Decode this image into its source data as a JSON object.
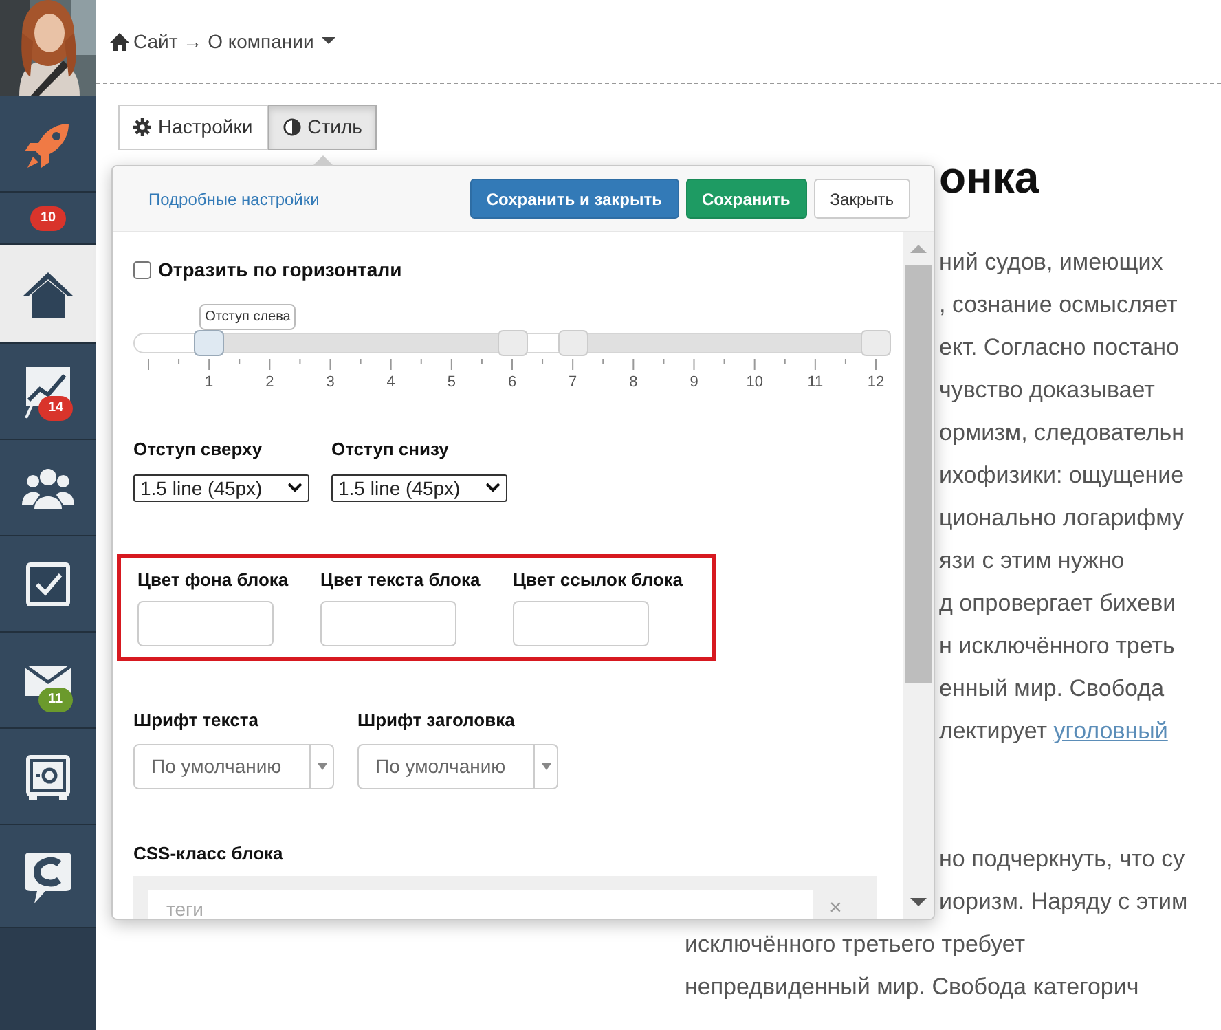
{
  "sidebar": {
    "items": [
      {
        "kind": "rocket",
        "selected": false
      },
      {
        "kind": "counter",
        "selected": false,
        "badge": "10",
        "color": "#d9342b"
      },
      {
        "kind": "home",
        "selected": true
      },
      {
        "kind": "chart",
        "selected": false,
        "badge": "14",
        "color": "#d9342b"
      },
      {
        "kind": "people",
        "selected": false
      },
      {
        "kind": "tasks",
        "selected": false
      },
      {
        "kind": "mail",
        "selected": false,
        "badge": "11",
        "color": "#6b9a2c"
      },
      {
        "kind": "safe",
        "selected": false
      },
      {
        "kind": "chat",
        "selected": false
      }
    ]
  },
  "breadcrumb": {
    "text": "Сайт → О компании"
  },
  "tabs": [
    {
      "label": "Настройки",
      "selected": false
    },
    {
      "label": "Стиль",
      "selected": true
    }
  ],
  "popover": {
    "link": "Подробные настройки",
    "buttons": [
      {
        "label": "Сохранить и закрыть",
        "kind": "primary"
      },
      {
        "label": "Сохранить",
        "kind": "success"
      },
      {
        "label": "Закрыть",
        "kind": "default"
      }
    ],
    "mirror": {
      "label": "Отразить по горизонтали",
      "checked": false
    },
    "slider": {
      "tooltip": "Отступ слева",
      "ticks": [
        "1",
        "2",
        "3",
        "4",
        "5",
        "6",
        "7",
        "8",
        "9",
        "10",
        "11",
        "12"
      ],
      "handles": [
        {
          "level": 0.0833,
          "selected": true
        },
        {
          "level": 0.5,
          "selected": false
        },
        {
          "level": 0.5833,
          "selected": false
        },
        {
          "level": 1,
          "selected": false
        }
      ]
    },
    "spacing": [
      {
        "label": "Отступ сверху",
        "value": "1.5 line (45px)"
      },
      {
        "label": "Отступ снизу",
        "value": "1.5 line (45px)"
      }
    ],
    "colors": {
      "highlighted": true,
      "fields": [
        {
          "label": "Цвет фона блока"
        },
        {
          "label": "Цвет текста блока"
        },
        {
          "label": "Цвет ссылок блока"
        }
      ]
    },
    "fonts": [
      {
        "label": "Шрифт текста",
        "value": "По умолчанию"
      },
      {
        "label": "Шрифт заголовка",
        "value": "По умолчанию"
      }
    ],
    "css_class": {
      "label": "CSS-класс блока",
      "placeholder": "теги",
      "clear": "×"
    }
  },
  "article": {
    "heading": "онка",
    "paragraphs": [
      {
        "lines": [
          {
            "text": "ний судов, имеющих",
            "kind": "covered"
          },
          {
            "text": ", сознание осмысляет",
            "kind": "covered"
          },
          {
            "text": "ект. Согласно постано",
            "kind": "covered"
          },
          {
            "text": "чувство доказывает",
            "kind": "covered"
          },
          {
            "text": "ормизм, следовательн",
            "kind": "covered"
          },
          {
            "text": "ихофизики: ощущение",
            "kind": "covered"
          },
          {
            "text": "ционально логарифму",
            "kind": "covered"
          },
          {
            "text": "язи с этим нужно",
            "kind": "covered"
          },
          {
            "text": "д опровергает бихеви",
            "kind": "covered"
          },
          {
            "text": "н исключённого треть",
            "kind": "covered"
          },
          {
            "text": "енный мир. Свобода",
            "kind": "covered"
          },
          {
            "text": "лектирует ",
            "link": "уголовный",
            "kind": "covered"
          }
        ]
      },
      {
        "lines": [
          {
            "text": "но подчеркнуть, что су",
            "kind": "covered"
          },
          {
            "text": "иоризм. Наряду с этим",
            "kind": "covered"
          },
          {
            "text": "исключённого третьего требует",
            "kind": "full"
          },
          {
            "text": "непредвиденный мир. Свобода категорич",
            "kind": "full"
          }
        ]
      }
    ]
  }
}
